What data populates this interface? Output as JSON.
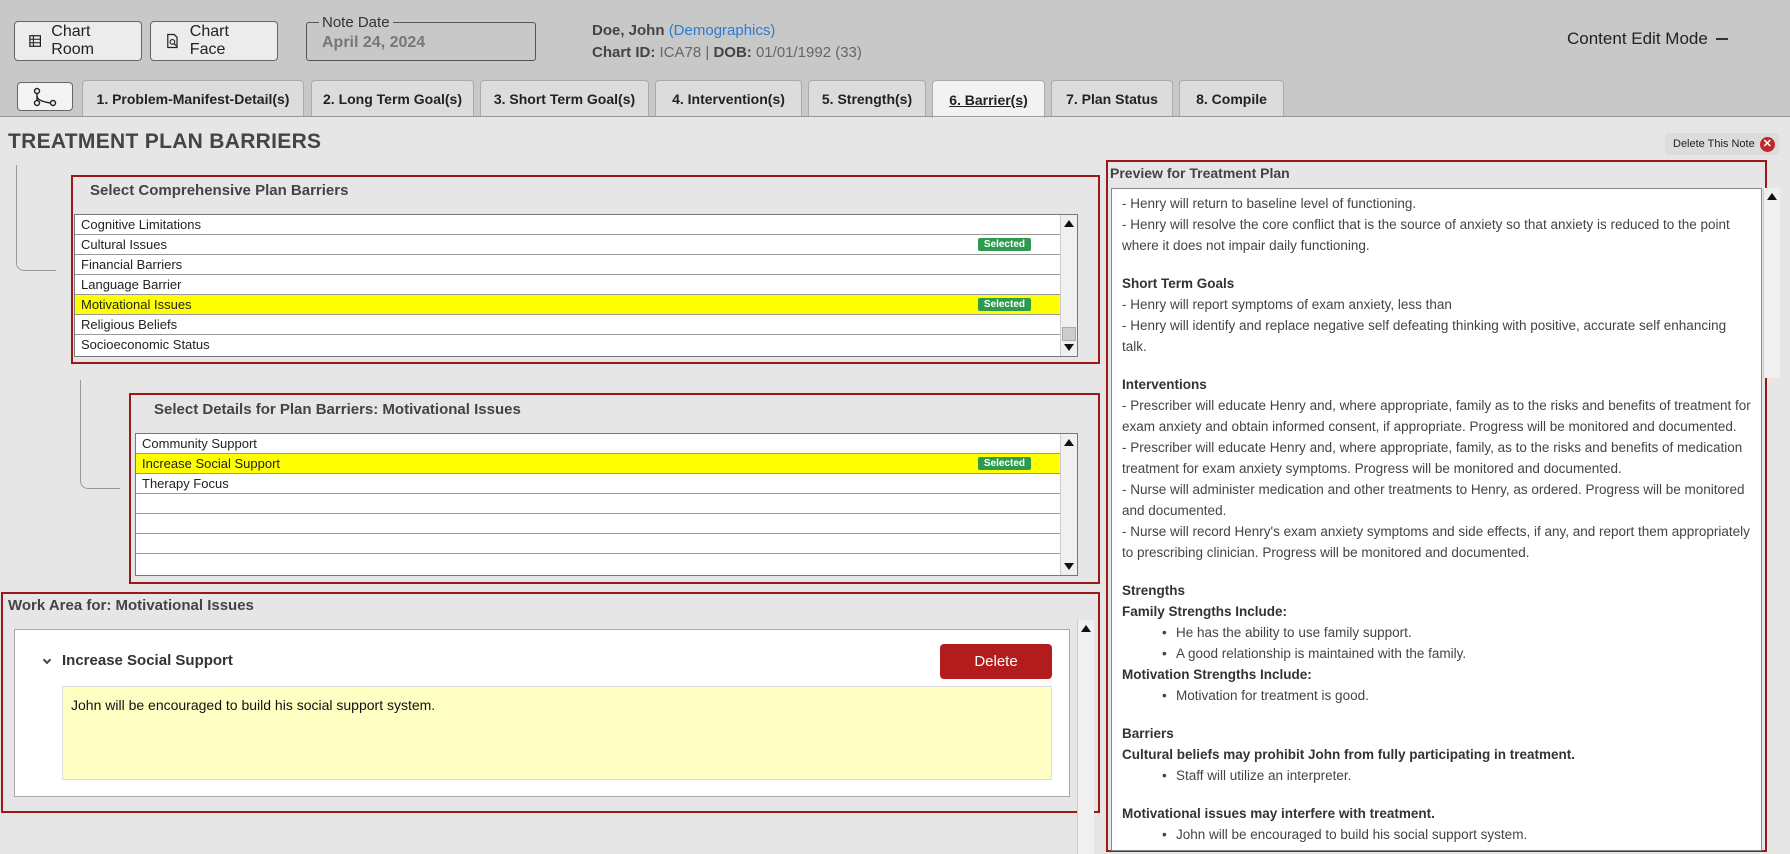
{
  "toolbar": {
    "chart_room": "Chart Room",
    "chart_face": "Chart Face",
    "note_date_label": "Note Date",
    "note_date_value": "April 24, 2024",
    "content_edit_mode": "Content Edit Mode"
  },
  "patient": {
    "name": "Doe, John",
    "demographics_link": "(Demographics)",
    "chart_id_label": "Chart ID:",
    "chart_id": "ICA78",
    "separator": "|",
    "dob_label": "DOB:",
    "dob": "01/01/1992 (33)"
  },
  "tabs": [
    {
      "label": "1. Problem-Manifest-Detail(s)",
      "active": false
    },
    {
      "label": "2. Long Term Goal(s)",
      "active": false
    },
    {
      "label": "3. Short Term Goal(s)",
      "active": false
    },
    {
      "label": "4. Intervention(s)",
      "active": false
    },
    {
      "label": "5. Strength(s)",
      "active": false
    },
    {
      "label": "6. Barrier(s)",
      "active": true
    },
    {
      "label": "7. Plan Status",
      "active": false
    },
    {
      "label": "8. Compile",
      "active": false
    }
  ],
  "page": {
    "title": "TREATMENT PLAN BARRIERS",
    "delete_note": "Delete This Note"
  },
  "barriers": {
    "title": "Select Comprehensive Plan Barriers",
    "items": [
      {
        "label": "Cognitive Limitations",
        "badge": "",
        "highlight": false
      },
      {
        "label": "Cultural Issues",
        "badge": "Selected",
        "highlight": false
      },
      {
        "label": "Financial Barriers",
        "badge": "",
        "highlight": false
      },
      {
        "label": "Language Barrier",
        "badge": "",
        "highlight": false
      },
      {
        "label": "Motivational Issues",
        "badge": "Selected",
        "highlight": true
      },
      {
        "label": "Religious Beliefs",
        "badge": "",
        "highlight": false
      },
      {
        "label": "Socioeconomic Status",
        "badge": "",
        "highlight": false
      }
    ]
  },
  "details": {
    "title": "Select Details for Plan Barriers: Motivational Issues",
    "items": [
      {
        "label": "Community Support",
        "badge": "",
        "highlight": false
      },
      {
        "label": "Increase Social Support",
        "badge": "Selected",
        "highlight": true
      },
      {
        "label": "Therapy Focus",
        "badge": "",
        "highlight": false
      },
      {
        "label": "",
        "badge": "",
        "highlight": false
      },
      {
        "label": "",
        "badge": "",
        "highlight": false
      },
      {
        "label": "",
        "badge": "",
        "highlight": false
      },
      {
        "label": "",
        "badge": "",
        "highlight": false
      }
    ]
  },
  "work_area": {
    "title": "Work Area for: Motivational Issues",
    "item_label": "Increase Social Support",
    "delete_button": "Delete",
    "note_text": "John will be encouraged to build his social support system."
  },
  "preview": {
    "title": "Preview for Treatment Plan",
    "lines": [
      {
        "text": "-  Henry will return to baseline level of functioning.",
        "style": "p"
      },
      {
        "text": "-  Henry will resolve the core conflict that is the source of anxiety so that anxiety is reduced to the point where it does not impair daily functioning.",
        "style": "p"
      },
      {
        "text": "",
        "style": "sp"
      },
      {
        "text": "Short Term Goals",
        "style": "h"
      },
      {
        "text": "-  Henry will report symptoms of exam anxiety, less than",
        "style": "p"
      },
      {
        "text": "-  Henry will identify and replace negative self defeating thinking with positive, accurate self enhancing talk.",
        "style": "p"
      },
      {
        "text": "",
        "style": "sp"
      },
      {
        "text": "Interventions",
        "style": "h"
      },
      {
        "text": "-  Prescriber will educate Henry and, where appropriate, family as to the risks and benefits of treatment for exam anxiety and obtain informed consent, if appropriate. Progress will be monitored and documented.",
        "style": "p"
      },
      {
        "text": "-  Prescriber will educate Henry and, where appropriate, family, as to the risks and benefits of medication treatment for exam anxiety symptoms. Progress will be monitored and documented.",
        "style": "p"
      },
      {
        "text": "-  Nurse will administer medication and other treatments to Henry, as ordered. Progress will be monitored and documented.",
        "style": "p"
      },
      {
        "text": "-  Nurse will record Henry's exam anxiety symptoms and side effects, if any, and report them appropriately to prescribing clinician. Progress will be monitored and documented.",
        "style": "p"
      },
      {
        "text": "",
        "style": "sp"
      },
      {
        "text": "Strengths",
        "style": "h"
      },
      {
        "text": "Family Strengths Include:",
        "style": "h"
      },
      {
        "text": "He has the ability to use family support.",
        "style": "bul"
      },
      {
        "text": "A good relationship is maintained with the family.",
        "style": "bul"
      },
      {
        "text": "Motivation Strengths Include:",
        "style": "h"
      },
      {
        "text": "Motivation for treatment is good.",
        "style": "bul"
      },
      {
        "text": "",
        "style": "sp"
      },
      {
        "text": "Barriers",
        "style": "h"
      },
      {
        "text": "Cultural beliefs may prohibit John from fully participating in treatment.",
        "style": "h"
      },
      {
        "text": "Staff will utilize an interpreter.",
        "style": "bul"
      },
      {
        "text": "",
        "style": "sp"
      },
      {
        "text": "Motivational issues may interfere with treatment.",
        "style": "h"
      },
      {
        "text": "John will be encouraged to build his social support system.",
        "style": "bul"
      }
    ]
  },
  "colors": {
    "accent_red": "#9a1a1a",
    "badge_green": "#2e9a4e",
    "highlight_yellow": "#ffff00",
    "link_blue": "#2a7ad6",
    "note_bg": "#ffffc4"
  }
}
